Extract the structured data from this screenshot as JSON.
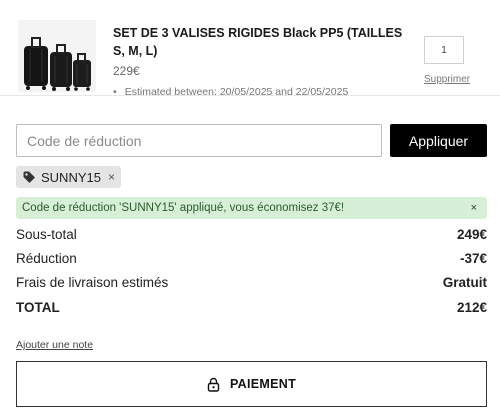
{
  "product": {
    "title": "SET DE 3 VALISES RIGIDES Black PP5 (TAILLES S, M, L)",
    "price": "229€",
    "estimate": "Estimated between: 20/05/2025 and 22/05/2025",
    "quantity": "1",
    "remove_label": "Supprimer",
    "image_icon": "suitcase-set-image"
  },
  "discount": {
    "placeholder": "Code de réduction",
    "value": "",
    "apply_label": "Appliquer",
    "applied_code": "SUNNY15",
    "tag_icon": "tag-icon",
    "notice": "Code de réduction 'SUNNY15' appliqué, vous économisez 37€!",
    "notice_close": "×",
    "tag_close": "×"
  },
  "totals": {
    "subtotal_label": "Sous-total",
    "subtotal_value": "249€",
    "discount_label": "Réduction",
    "discount_value": "-37€",
    "shipping_label": "Frais de livraison estimés",
    "shipping_value": "Gratuit",
    "total_label": "TOTAL",
    "total_value": "212€"
  },
  "note_link": "Ajouter une note",
  "checkout": {
    "label": "PAIEMENT",
    "icon": "lock-icon"
  },
  "colors": {
    "notice_bg": "#d6efd6",
    "notice_text": "#2d5a2d",
    "apply_bg": "#000000",
    "tag_bg": "#e4e4e4"
  }
}
